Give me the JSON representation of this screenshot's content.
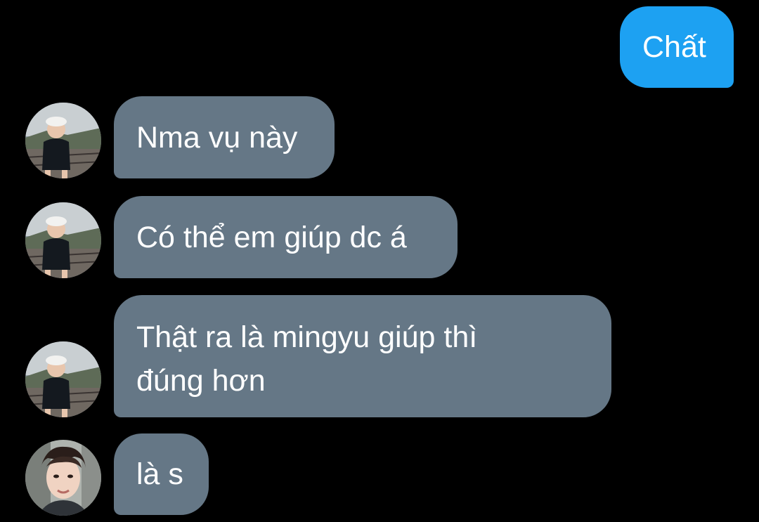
{
  "messages": [
    {
      "direction": "outgoing",
      "text": "Chất"
    },
    {
      "direction": "incoming",
      "sender_avatar": "child-photo-avatar",
      "text": "Nma vụ này"
    },
    {
      "direction": "incoming",
      "sender_avatar": "child-photo-avatar",
      "text": "Có thể em giúp dc á"
    },
    {
      "direction": "incoming",
      "sender_avatar": "child-photo-avatar",
      "text_lines": [
        "Thật ra là mingyu giúp thì",
        "đúng hơn"
      ]
    },
    {
      "direction": "incoming",
      "sender_avatar": "man-photo-avatar",
      "text": "là s"
    }
  ],
  "colors": {
    "background": "#000000",
    "outgoing_bubble": "#1da1f2",
    "incoming_bubble": "#657786",
    "text": "#ffffff"
  }
}
